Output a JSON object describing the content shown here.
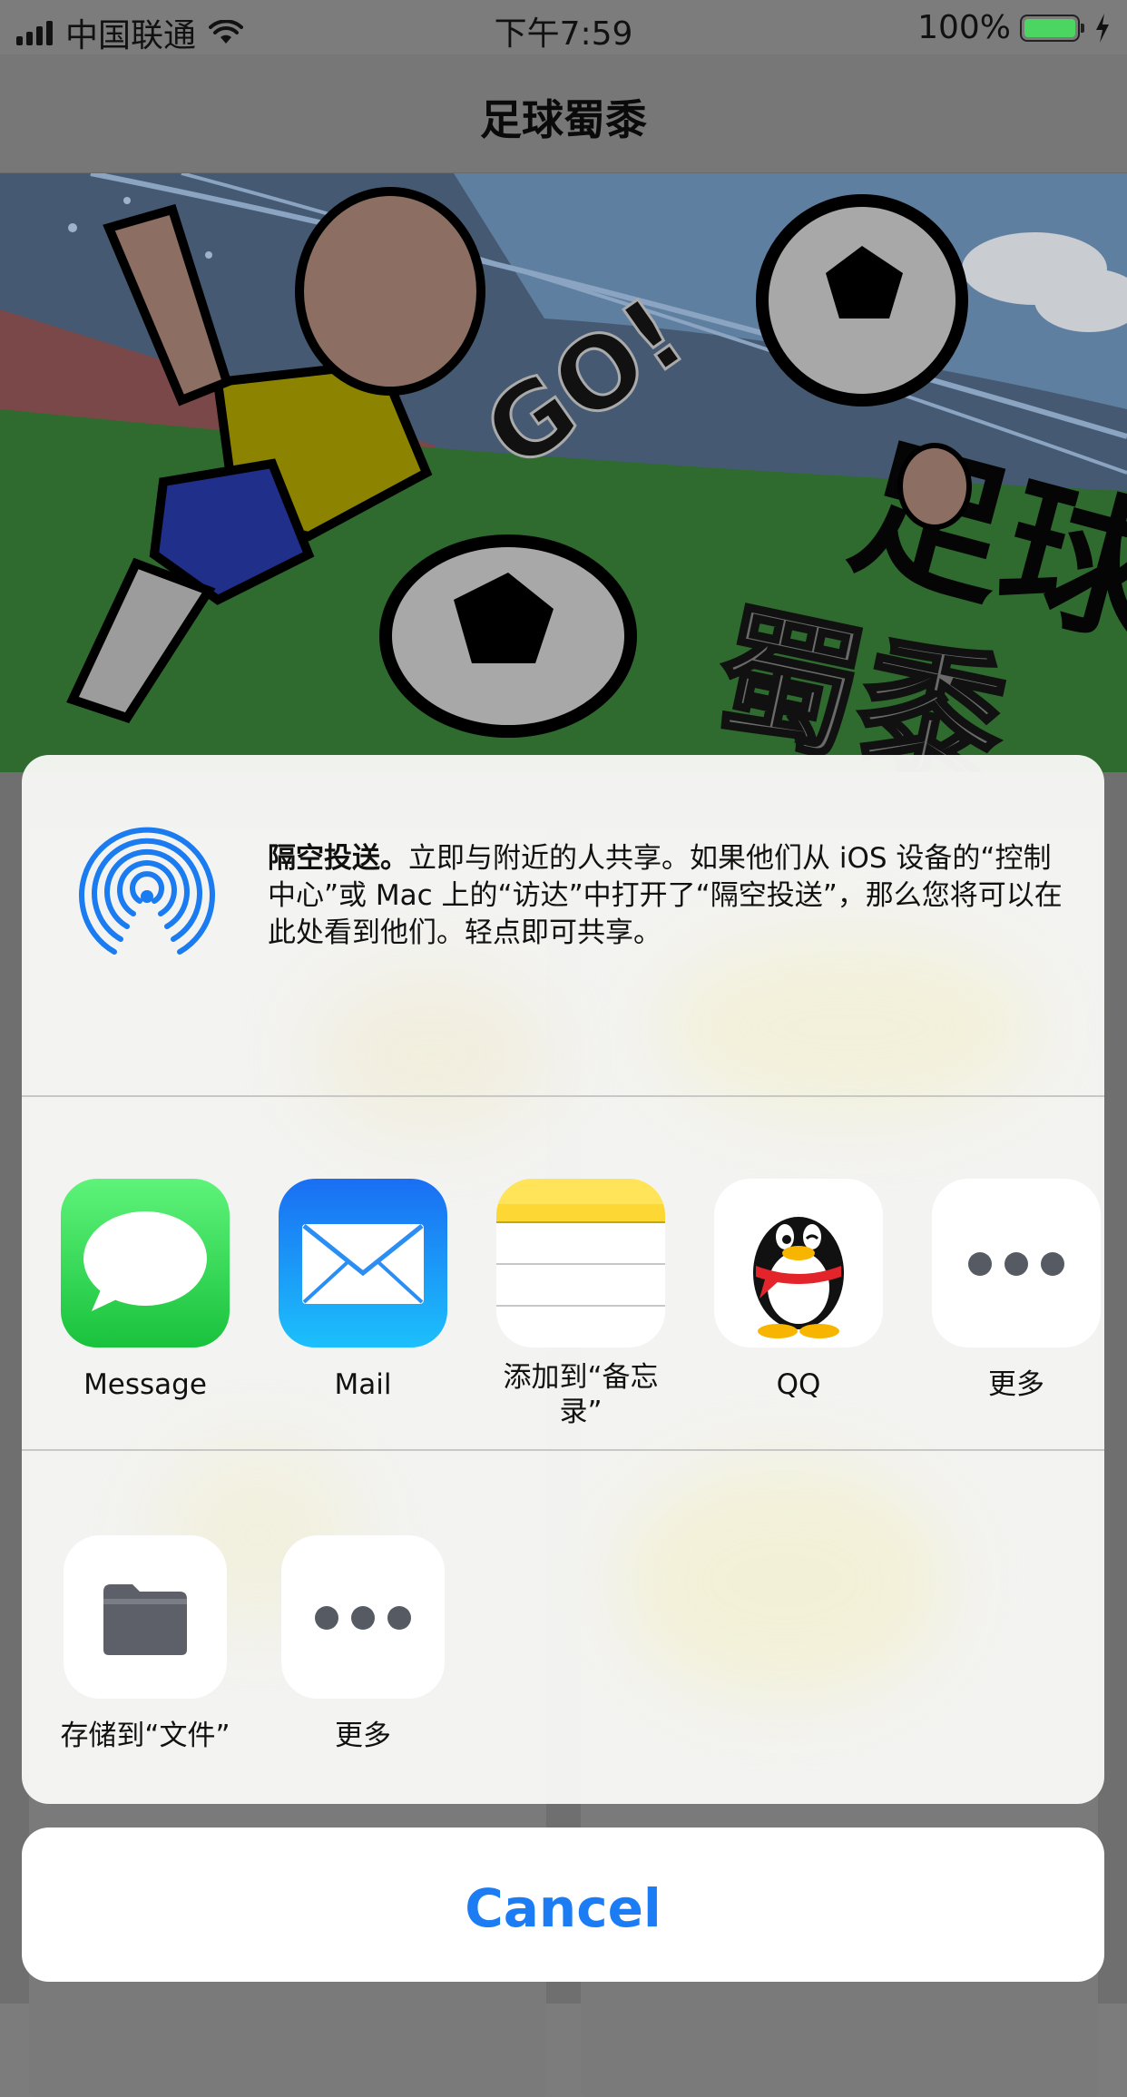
{
  "status_bar": {
    "carrier": "中国联通",
    "time": "下午7:59",
    "battery": "100%",
    "battery_level": 1.0
  },
  "nav": {
    "title": "足球蜀黍"
  },
  "banner": {
    "go_text": "GO!",
    "art_title_1": "足球",
    "art_title_2": "蜀黍"
  },
  "share_sheet": {
    "airdrop": {
      "title": "隔空投送。",
      "description": "立即与附近的人共享。如果他们从 iOS 设备的“控制中心”或 Mac 上的“访达”中打开了“隔空投送”，那么您将可以在此处看到他们。轻点即可共享。"
    },
    "share_apps": [
      {
        "label": "Message",
        "icon": "messages-icon"
      },
      {
        "label": "Mail",
        "icon": "mail-icon"
      },
      {
        "label": "添加到“备忘录”",
        "icon": "notes-icon"
      },
      {
        "label": "QQ",
        "icon": "qq-penguin-icon"
      },
      {
        "label": "更多",
        "icon": "more-dots-icon"
      }
    ],
    "actions": [
      {
        "label": "存储到“文件”",
        "icon": "folder-icon"
      },
      {
        "label": "更多",
        "icon": "more-dots-icon"
      }
    ],
    "cancel_label": "Cancel"
  },
  "colors": {
    "accent": "#1b7cf4",
    "airdrop_blue": "#1a7cf0",
    "messages_green": "#34c759",
    "mail_blue": "#1f8ff5",
    "notes_yellow": "#fdd835",
    "qq_scarf_red": "#e3242b",
    "battery_green": "#4bd662"
  }
}
